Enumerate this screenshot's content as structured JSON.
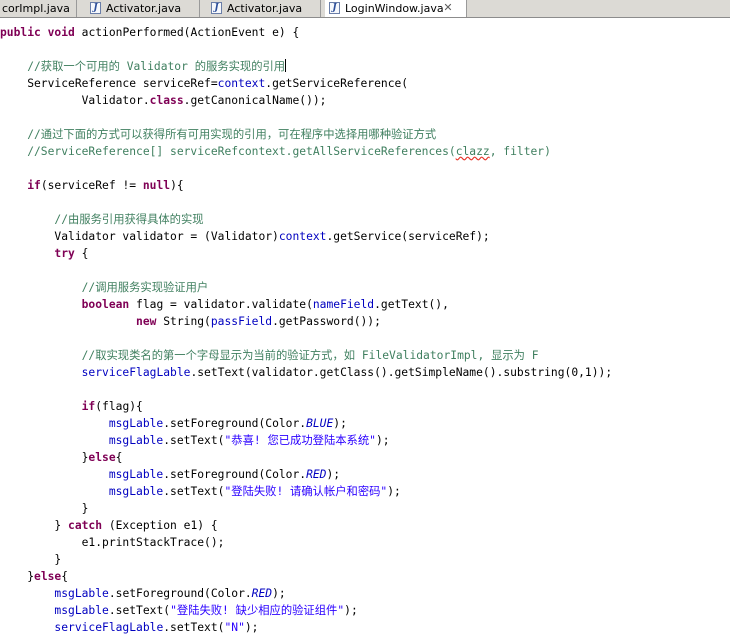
{
  "tabs": [
    {
      "label": "corImpl.java",
      "active": false,
      "icon": "java-file-icon"
    },
    {
      "label": "Activator.java",
      "active": false,
      "icon": "java-file-icon"
    },
    {
      "label": "Activator.java",
      "active": false,
      "icon": "java-file-icon"
    },
    {
      "label": "LoginWindow.java",
      "active": true,
      "icon": "java-file-icon",
      "close": "✕"
    }
  ],
  "code": {
    "l01": {
      "a": "public",
      "b": " ",
      "c": "void",
      "d": " actionPerformed(ActionEvent e) {"
    },
    "l02": {
      "a": "    //获取一个可用的 ",
      "b": "Validator",
      "c": " 的服务实现的引用"
    },
    "l03": {
      "a": "    ServiceReference serviceRef=",
      "b": "context",
      "c": ".getServiceReference("
    },
    "l04": {
      "a": "            Validator.",
      "b": "class",
      "c": ".getCanonicalName());"
    },
    "l05": {
      "a": "    //通过下面的方式可以获得所有可用实现的引用，可在程序中选择用哪种验证方式"
    },
    "l06": {
      "a": "    //ServiceReference[] serviceRefcontext.getAllServiceReferences(",
      "b": "clazz",
      "c": ", filter)"
    },
    "l07": {
      "a": "    ",
      "b": "if",
      "c": "(serviceRef != ",
      "d": "null",
      "e": "){"
    },
    "l08": {
      "a": "        //由服务引用获得具体的实现"
    },
    "l09": {
      "a": "        Validator validator = (Validator)",
      "b": "context",
      "c": ".getService(serviceRef);"
    },
    "l10": {
      "a": "        ",
      "b": "try",
      "c": " {"
    },
    "l11": {
      "a": "            //调用服务实现验证用户"
    },
    "l12": {
      "a": "            ",
      "b": "boolean",
      "c": " flag = validator.validate(",
      "d": "nameField",
      "e": ".getText(),"
    },
    "l13": {
      "a": "                    ",
      "b": "new",
      "c": " String(",
      "d": "passField",
      "e": ".getPassword());"
    },
    "l14": {
      "a": "            //取实现类名的第一个字母显示为当前的验证方式，如 FileValidatorImpl, 显示为 F"
    },
    "l15": {
      "a": "            ",
      "b": "serviceFlagLable",
      "c": ".setText(validator.getClass().getSimpleName().substring(0,1));"
    },
    "l16": {
      "a": "            ",
      "b": "if",
      "c": "(flag){"
    },
    "l17": {
      "a": "                ",
      "b": "msgLable",
      "c": ".setForeground(Color.",
      "d": "BLUE",
      "e": ");"
    },
    "l18": {
      "a": "                ",
      "b": "msgLable",
      "c": ".setText(",
      "d": "\"恭喜! 您已成功登陆本系统\"",
      "e": ");"
    },
    "l19": {
      "a": "            }",
      "b": "else",
      "c": "{"
    },
    "l20": {
      "a": "                ",
      "b": "msgLable",
      "c": ".setForeground(Color.",
      "d": "RED",
      "e": ");"
    },
    "l21": {
      "a": "                ",
      "b": "msgLable",
      "c": ".setText(",
      "d": "\"登陆失败! 请确认帐户和密码\"",
      "e": ");"
    },
    "l22": {
      "a": "            }"
    },
    "l23": {
      "a": "        } ",
      "b": "catch",
      "c": " (Exception e1) {"
    },
    "l24": {
      "a": "            e1.printStackTrace();"
    },
    "l25": {
      "a": "        }"
    },
    "l26": {
      "a": "    }",
      "b": "else",
      "c": "{"
    },
    "l27": {
      "a": "        ",
      "b": "msgLable",
      "c": ".setForeground(Color.",
      "d": "RED",
      "e": ");"
    },
    "l28": {
      "a": "        ",
      "b": "msgLable",
      "c": ".setText(",
      "d": "\"登陆失败! 缺少相应的验证组件\"",
      "e": ");"
    },
    "l29": {
      "a": "        ",
      "b": "serviceFlagLable",
      "c": ".setText(",
      "d": "\"N\"",
      "e": ");"
    }
  },
  "colors": {
    "keyword": "#7f0055",
    "comment": "#3f7f5f",
    "field": "#0000c0",
    "string": "#2a00ff"
  }
}
